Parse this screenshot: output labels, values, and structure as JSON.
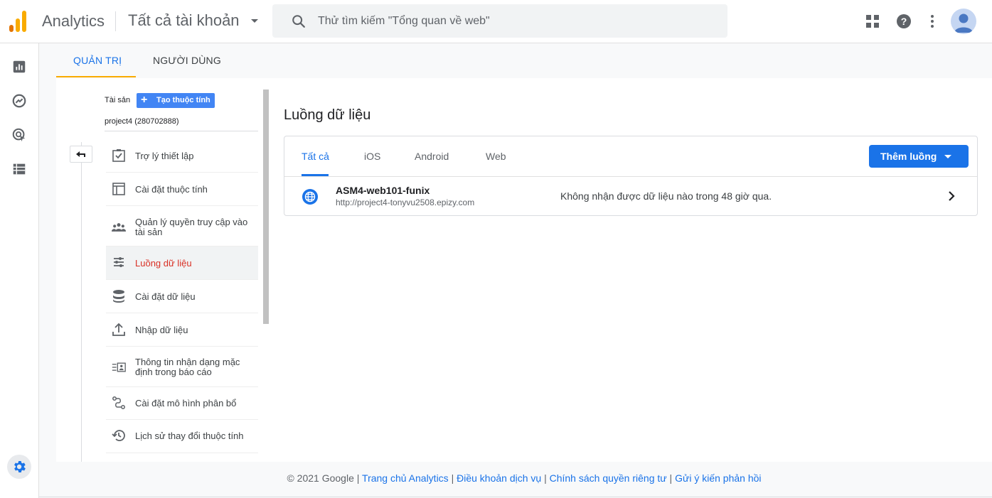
{
  "header": {
    "app_name": "Analytics",
    "account_selector": "Tất cả tài khoản",
    "search_placeholder": "Thử tìm kiếm \"Tổng quan về web\"",
    "icons": [
      "apps-grid-icon",
      "help-icon",
      "more-vert-icon",
      "account-avatar"
    ]
  },
  "colors": {
    "accent_blue": "#1a73e8",
    "active_red": "#d93025",
    "tab_indicator_yellow": "#f9ab00",
    "logo_orange": "#f9ab00",
    "logo_dark_orange": "#e37400"
  },
  "left_rail": {
    "items": [
      "reports-icon",
      "explore-icon",
      "advertising-icon",
      "configure-icon"
    ],
    "footer_icon": "settings-gear-icon"
  },
  "admin_tabs": [
    {
      "label": "QUẢN TRỊ",
      "active": true
    },
    {
      "label": "NGƯỜI DÙNG",
      "active": false
    }
  ],
  "property": {
    "label": "Tài sản",
    "create_button": "Tạo thuộc tính",
    "name": "project4 (280702888)"
  },
  "menu": [
    {
      "label": "Trợ lý thiết lập",
      "icon": "checkbox-icon",
      "active": false
    },
    {
      "label": "Cài đặt thuộc tính",
      "icon": "property-settings-icon",
      "active": false
    },
    {
      "label": "Quản lý quyền truy cập vào tài sản",
      "icon": "people-icon",
      "active": false
    },
    {
      "label": "Luồng dữ liệu",
      "icon": "data-streams-icon",
      "active": true
    },
    {
      "label": "Cài đặt dữ liệu",
      "icon": "database-icon",
      "active": false
    },
    {
      "label": "Nhập dữ liệu",
      "icon": "upload-icon",
      "active": false
    },
    {
      "label": "Thông tin nhận dạng mặc định trong báo cáo",
      "icon": "identity-icon",
      "active": false
    },
    {
      "label": "Cài đặt mô hình phân bổ",
      "icon": "attribution-icon",
      "active": false
    },
    {
      "label": "Lịch sử thay đổi thuộc tính",
      "icon": "history-icon",
      "active": false
    }
  ],
  "content": {
    "title": "Luồng dữ liệu",
    "stream_tabs": [
      {
        "label": "Tất cả",
        "active": true
      },
      {
        "label": "iOS",
        "active": false
      },
      {
        "label": "Android",
        "active": false
      },
      {
        "label": "Web",
        "active": false
      }
    ],
    "add_stream_button": "Thêm luồng",
    "streams": [
      {
        "name": "ASM4-web101-funix",
        "url": "http://project4-tonyvu2508.epizy.com",
        "status": "Không nhận được dữ liệu nào trong 48 giờ qua."
      }
    ]
  },
  "footer": {
    "copyright": "© 2021 Google",
    "separator": " | ",
    "links": [
      "Trang chủ Analytics",
      "Điều khoản dịch vụ",
      "Chính sách quyền riêng tư",
      "Gửi ý kiến phản hồi"
    ]
  }
}
